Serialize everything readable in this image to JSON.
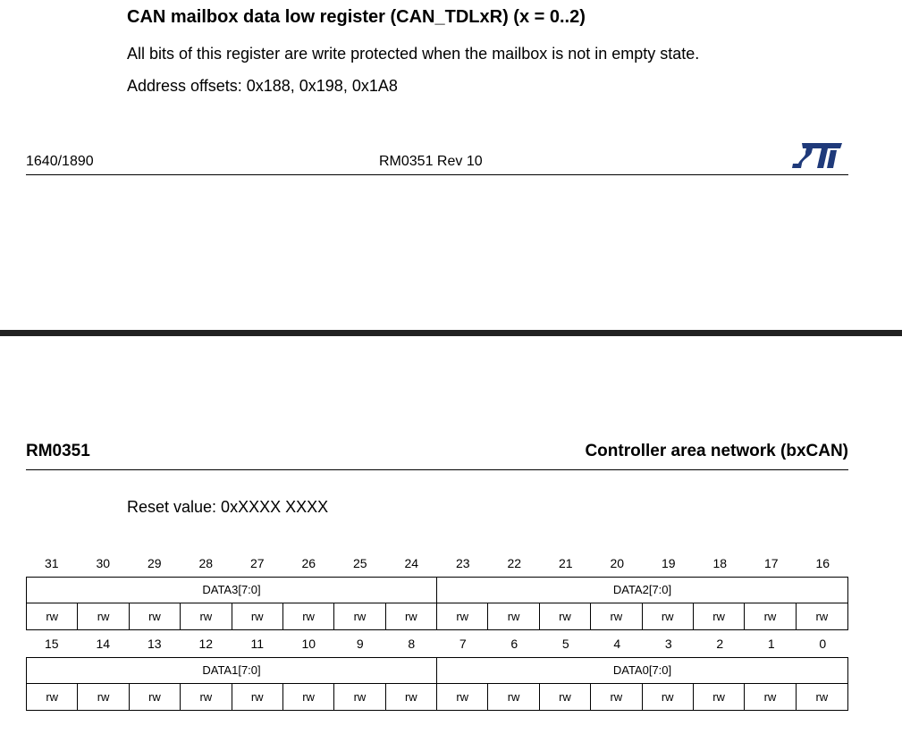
{
  "register": {
    "title": "CAN mailbox data low register (CAN_TDLxR) (x = 0..2)",
    "note": "All bits of this register are write protected when the mailbox is not in empty state.",
    "address": "Address offsets: 0x188, 0x198, 0x1A8",
    "reset": "Reset value: 0xXXXX XXXX"
  },
  "footer": {
    "page": "1640/1890",
    "doc_rev": "RM0351 Rev 10",
    "logo": "st-logo-icon"
  },
  "header": {
    "doc": "RM0351",
    "section": "Controller area network (bxCAN)"
  },
  "upper_half": {
    "bits": [
      "31",
      "30",
      "29",
      "28",
      "27",
      "26",
      "25",
      "24",
      "23",
      "22",
      "21",
      "20",
      "19",
      "18",
      "17",
      "16"
    ],
    "fields": [
      "DATA3[7:0]",
      "DATA2[7:0]"
    ],
    "access": [
      "rw",
      "rw",
      "rw",
      "rw",
      "rw",
      "rw",
      "rw",
      "rw",
      "rw",
      "rw",
      "rw",
      "rw",
      "rw",
      "rw",
      "rw",
      "rw"
    ]
  },
  "lower_half": {
    "bits": [
      "15",
      "14",
      "13",
      "12",
      "11",
      "10",
      "9",
      "8",
      "7",
      "6",
      "5",
      "4",
      "3",
      "2",
      "1",
      "0"
    ],
    "fields": [
      "DATA1[7:0]",
      "DATA0[7:0]"
    ],
    "access": [
      "rw",
      "rw",
      "rw",
      "rw",
      "rw",
      "rw",
      "rw",
      "rw",
      "rw",
      "rw",
      "rw",
      "rw",
      "rw",
      "rw",
      "rw",
      "rw"
    ]
  },
  "colors": {
    "text": "#000000",
    "page_break": "#222222",
    "logo": "#1f3a7a"
  }
}
